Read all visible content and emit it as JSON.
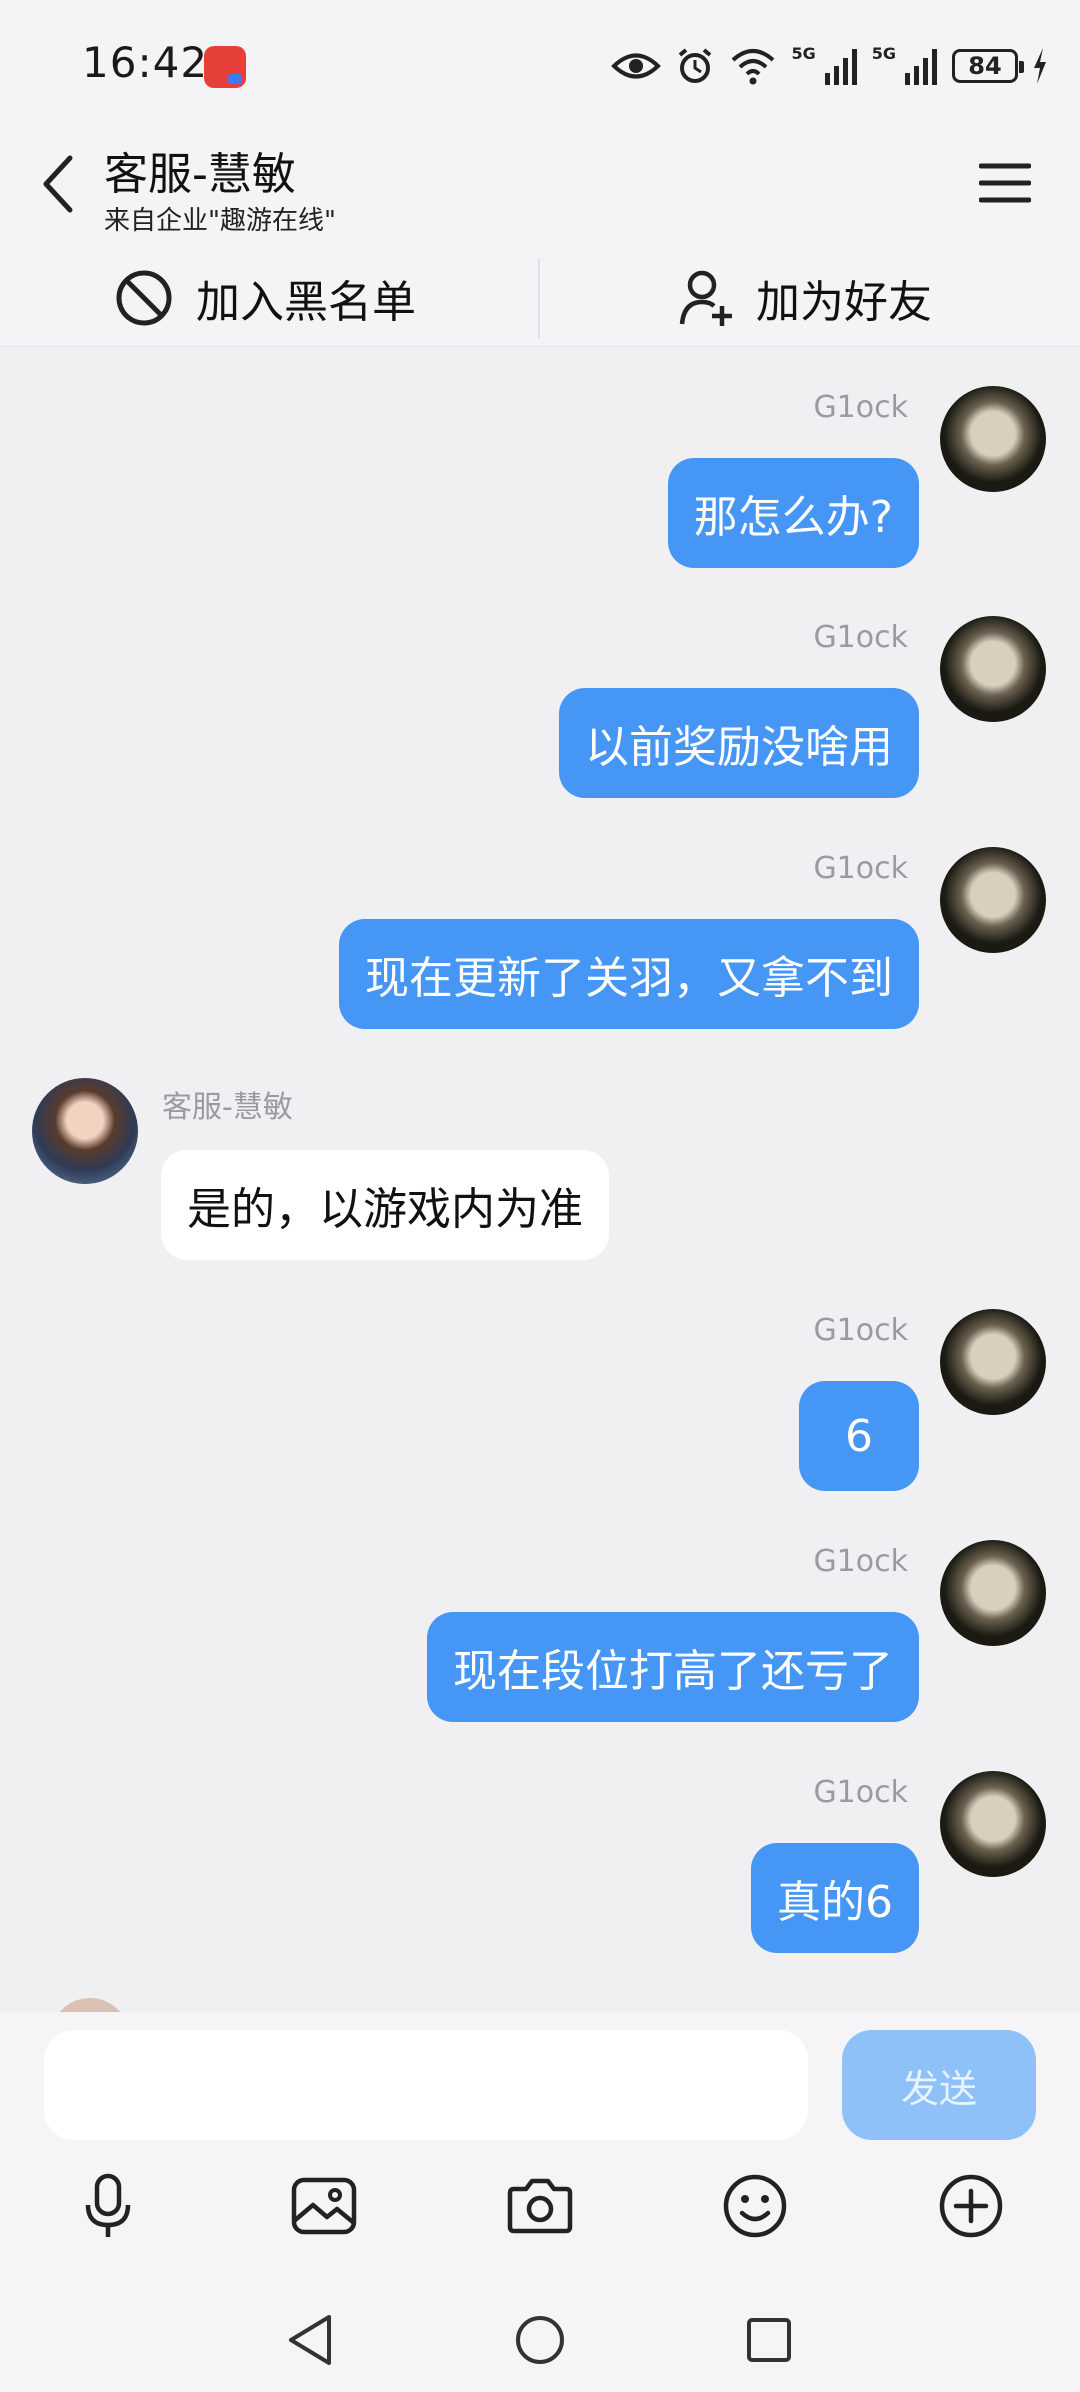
{
  "status_bar": {
    "time": "16:42",
    "signal_1": "5G",
    "signal_2": "5G",
    "battery": "84"
  },
  "header": {
    "title": "客服-慧敏",
    "subtitle": "来自企业\"趣游在线\""
  },
  "actions": {
    "block_label": "加入黑名单",
    "add_friend_label": "加为好友"
  },
  "messages": [
    {
      "sender": "G1ock",
      "text": "那怎么办?",
      "direction": "outgoing"
    },
    {
      "sender": "G1ock",
      "text": "以前奖励没啥用",
      "direction": "outgoing"
    },
    {
      "sender": "G1ock",
      "text": "现在更新了关羽，又拿不到",
      "direction": "outgoing"
    },
    {
      "sender": "客服-慧敏",
      "text": "是的，以游戏内为准",
      "direction": "incoming"
    },
    {
      "sender": "G1ock",
      "text": "6",
      "direction": "outgoing"
    },
    {
      "sender": "G1ock",
      "text": "现在段位打高了还亏了",
      "direction": "outgoing"
    },
    {
      "sender": "G1ock",
      "text": "真的6",
      "direction": "outgoing"
    }
  ],
  "input": {
    "value": "",
    "send_label": "发送"
  },
  "toolbar": [
    "microphone-icon",
    "image-icon",
    "camera-icon",
    "emoji-icon",
    "plus-icon"
  ],
  "colors": {
    "outgoing_bubble": "#4696f5",
    "incoming_bubble": "#ffffff",
    "send_disabled": "#8ec1f7",
    "background": "#f0f0f3"
  }
}
